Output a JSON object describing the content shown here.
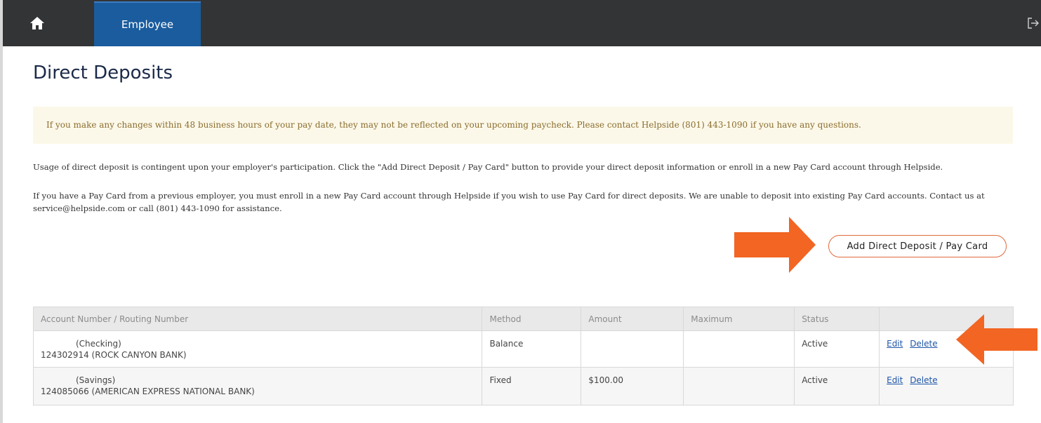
{
  "nav": {
    "home_icon": "home-icon",
    "active_tab": "Employee",
    "logout_icon": "logout-icon"
  },
  "page": {
    "title": "Direct Deposits"
  },
  "alert": {
    "text": "If you make any changes within 48 business hours of your pay date, they may not be reflected on your upcoming paycheck. Please contact Helpside (801) 443-1090 if you have any questions."
  },
  "info": {
    "paragraph_1": "Usage of direct deposit is contingent upon your employer's participation. Click the \"Add Direct Deposit / Pay Card\" button to provide your direct deposit information or enroll in a new Pay Card account through Helpside.",
    "paragraph_2": "If you have a Pay Card from a previous employer, you must enroll in a new Pay Card account through Helpside if you wish to use Pay Card for direct deposits. We are unable to deposit into existing Pay Card accounts. Contact us at service@helpside.com or call (801) 443-1090 for assistance."
  },
  "actions": {
    "add_label": "Add Direct Deposit / Pay Card"
  },
  "colors": {
    "nav_bg": "#333436",
    "tab_active": "#1a5c9e",
    "alert_bg": "#fcf8e9",
    "arrow": "#f26522",
    "link": "#1f56a8"
  },
  "table": {
    "headers": [
      "Account Number / Routing Number",
      "Method",
      "Amount",
      "Maximum",
      "Status",
      ""
    ],
    "rows": [
      {
        "account_type": "(Checking)",
        "routing": "124302914 (ROCK CANYON BANK)",
        "method": "Balance",
        "amount": "",
        "maximum": "",
        "status": "Active",
        "edit": "Edit",
        "delete": "Delete"
      },
      {
        "account_type": "(Savings)",
        "routing": "124085066 (AMERICAN EXPRESS NATIONAL BANK)",
        "method": "Fixed",
        "amount": "$100.00",
        "maximum": "",
        "status": "Active",
        "edit": "Edit",
        "delete": "Delete"
      }
    ]
  }
}
